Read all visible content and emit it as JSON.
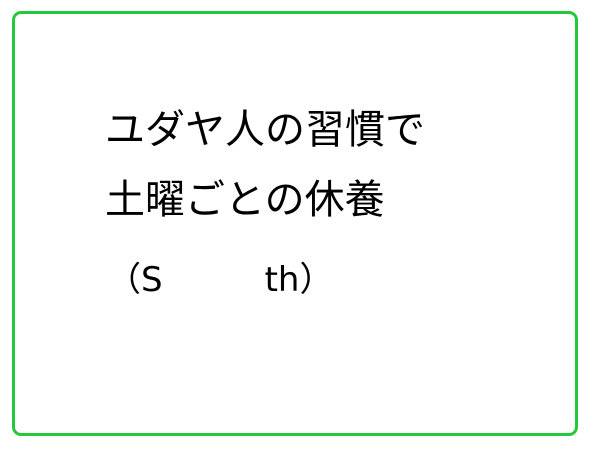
{
  "card": {
    "border_color": "#22c93a",
    "lines": [
      "ユダヤ人の習慣で",
      "土曜ごとの休養",
      "（S　　　th）"
    ]
  }
}
